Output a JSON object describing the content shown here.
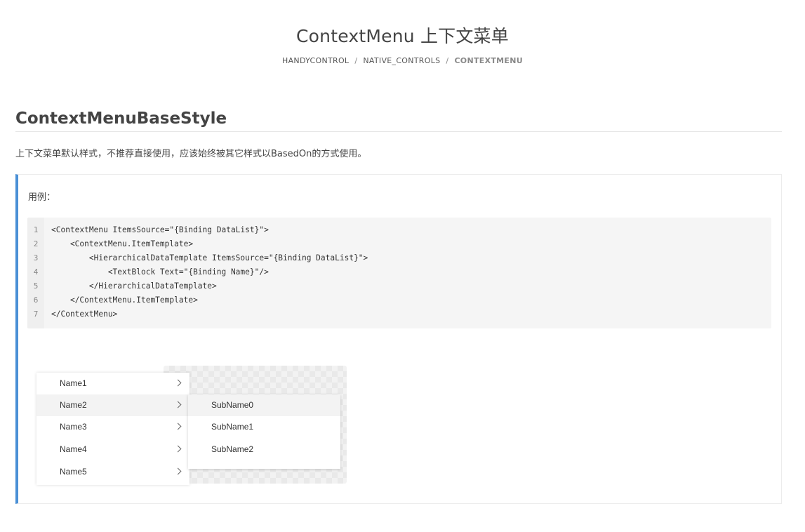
{
  "page": {
    "title": "ContextMenu 上下文菜单",
    "breadcrumb": [
      "HANDYCONTROL",
      "NATIVE_CONTROLS",
      "CONTEXTMENU"
    ],
    "separator": "/"
  },
  "section": {
    "title": "ContextMenuBaseStyle",
    "description": "上下文菜单默认样式，不推荐直接使用，应该始终被其它样式以BasedOn的方式使用。"
  },
  "example": {
    "label": "用例：",
    "code_lines": [
      {
        "no": "1",
        "text": "<ContextMenu ItemsSource=\"{Binding DataList}\">"
      },
      {
        "no": "2",
        "text": "    <ContextMenu.ItemTemplate>"
      },
      {
        "no": "3",
        "text": "        <HierarchicalDataTemplate ItemsSource=\"{Binding DataList}\">"
      },
      {
        "no": "4",
        "text": "            <TextBlock Text=\"{Binding Name}\"/>"
      },
      {
        "no": "5",
        "text": "        </HierarchicalDataTemplate>"
      },
      {
        "no": "6",
        "text": "    </ContextMenu.ItemTemplate>"
      },
      {
        "no": "7",
        "text": "</ContextMenu>"
      }
    ]
  },
  "demo": {
    "menu_items": [
      "Name1",
      "Name2",
      "Name3",
      "Name4",
      "Name5"
    ],
    "active_item": "Name2",
    "submenu_items": [
      "SubName0",
      "SubName1",
      "SubName2"
    ],
    "chevron_icon": "chevron-right-icon"
  },
  "colors": {
    "accent": "#4a90d6",
    "code_bg": "#f5f5f5",
    "hover_bg": "#f3f3f3"
  }
}
